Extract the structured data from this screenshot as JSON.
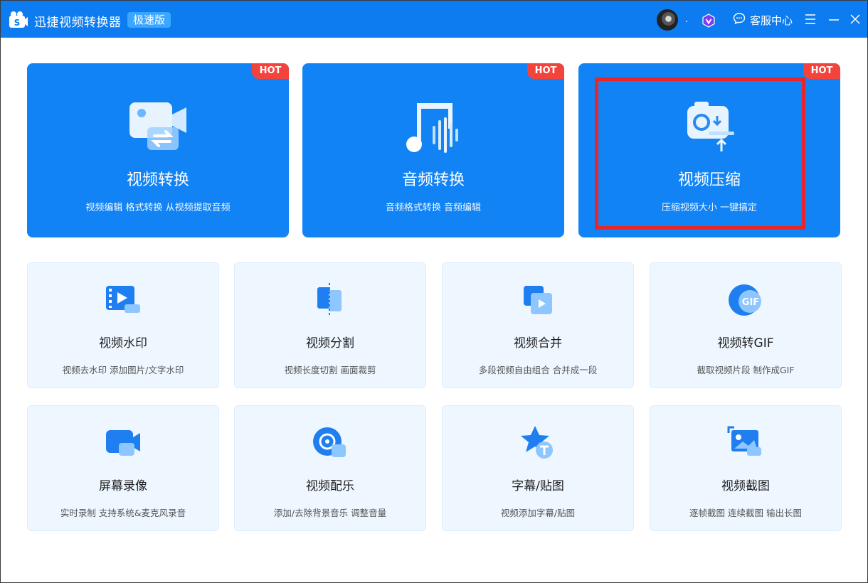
{
  "app": {
    "title": "迅捷视频转换器",
    "edition": "极速版",
    "user_dot": ".",
    "service_label": "客服中心"
  },
  "colors": {
    "titlebar": "#0d7cf0",
    "hot_card": "#1183f5",
    "hot_badge": "#f2433d",
    "highlight": "#e8262a",
    "tool_card": "#eef7ff"
  },
  "hot_cards": [
    {
      "title": "视频转换",
      "subtitle": "视频编辑 格式转换 从视频提取音频",
      "badge": "HOT",
      "icon": "video-convert-icon"
    },
    {
      "title": "音频转换",
      "subtitle": "音频格式转换 音频编辑",
      "badge": "HOT",
      "icon": "audio-convert-icon"
    },
    {
      "title": "视频压缩",
      "subtitle": "压缩视频大小 一键搞定",
      "badge": "HOT",
      "icon": "video-compress-icon"
    }
  ],
  "tools": [
    {
      "title": "视频水印",
      "subtitle": "视频去水印 添加图片/文字水印",
      "icon": "watermark-icon"
    },
    {
      "title": "视频分割",
      "subtitle": "视频长度切割 画面裁剪",
      "icon": "split-icon"
    },
    {
      "title": "视频合并",
      "subtitle": "多段视频自由组合 合并成一段",
      "icon": "merge-icon"
    },
    {
      "title": "视频转GIF",
      "subtitle": "截取视频片段 制作成GIF",
      "icon": "gif-icon"
    },
    {
      "title": "屏幕录像",
      "subtitle": "实时录制 支持系统&麦克风录音",
      "icon": "screen-record-icon"
    },
    {
      "title": "视频配乐",
      "subtitle": "添加/去除背景音乐 调整音量",
      "icon": "music-icon"
    },
    {
      "title": "字幕/贴图",
      "subtitle": "视频添加字幕/贴图",
      "icon": "subtitle-icon"
    },
    {
      "title": "视频截图",
      "subtitle": "逐帧截图 连续截图 输出长图",
      "icon": "screenshot-icon"
    }
  ]
}
